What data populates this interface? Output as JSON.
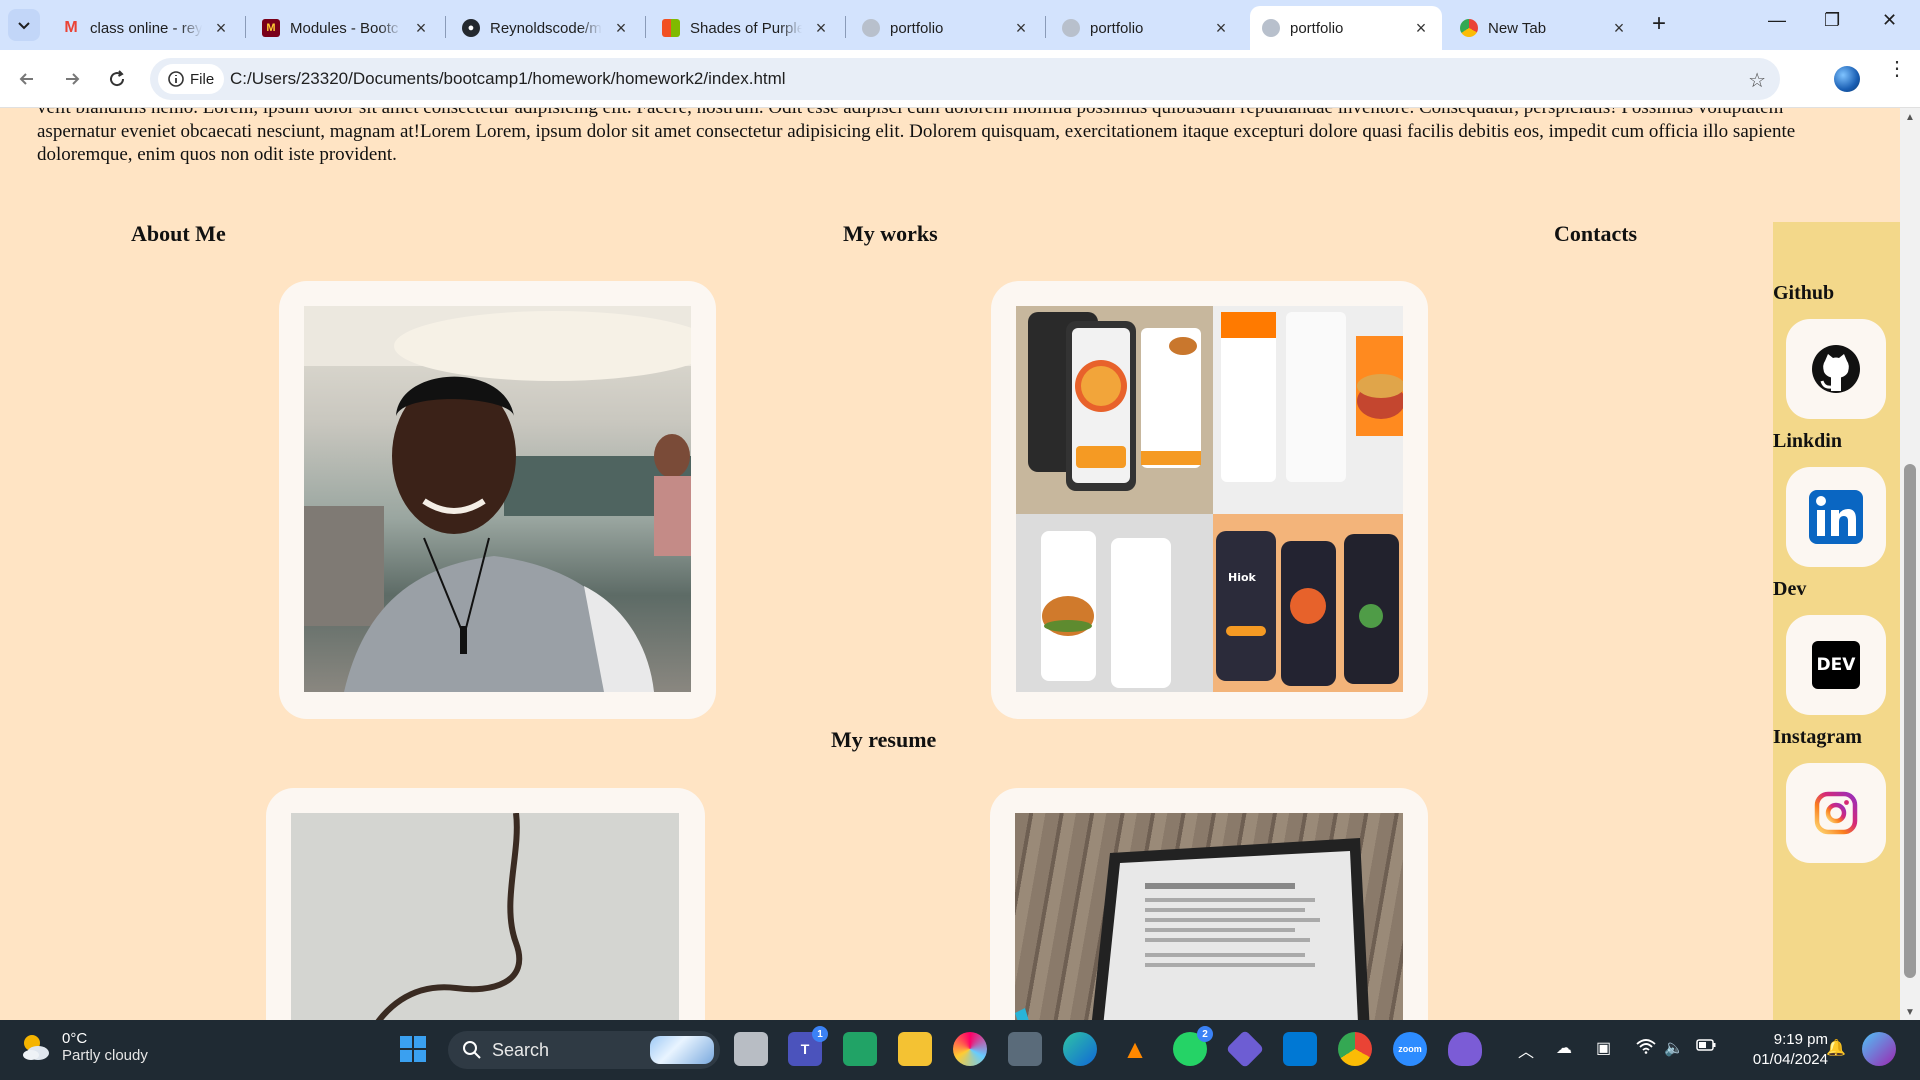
{
  "browser": {
    "tabs": [
      {
        "title": "class online - rey",
        "icon": "gmail-icon",
        "color": "#ea4335"
      },
      {
        "title": "Modules - Bootc",
        "icon": "minnesota-icon",
        "color": "#7a0019"
      },
      {
        "title": "Reynoldscode/m",
        "icon": "github-icon",
        "color": "#24292f"
      },
      {
        "title": "Shades of Purple",
        "icon": "microsoft-icon",
        "color": "#f25022"
      },
      {
        "title": "portfolio",
        "icon": "globe-icon",
        "color": "#9aa0a6"
      },
      {
        "title": "portfolio",
        "icon": "globe-icon",
        "color": "#9aa0a6"
      },
      {
        "title": "portfolio",
        "icon": "globe-icon",
        "color": "#9aa0a6"
      },
      {
        "title": "New Tab",
        "icon": "chrome-icon",
        "color": "#4285f4"
      }
    ],
    "active_tab": 6,
    "file_chip": "File",
    "url": "C:/Users/23320/Documents/bootcamp1/homework/homework2/index.html"
  },
  "page": {
    "paragraph": "velit blanditiis nemo. Lorem, ipsum dolor sit amet consectetur adipisicing elit. Facere, nostrum. Odit esse adipisci cum dolorem mollitia possimus quibusdam repudiandae inventore. Consequatur, perspiciatis! Possimus voluptatem aspernatur eveniet obcaecati nesciunt, magnam at!Lorem Lorem, ipsum dolor sit amet consectetur adipisicing elit. Dolorem quisquam, exercitationem itaque excepturi dolore quasi facilis debitis eos, impedit cum officia illo sapiente doloremque, enim quos non odit iste provident.",
    "headings": {
      "about": "About Me",
      "works": "My works",
      "contacts": "Contacts",
      "resume": "My resume"
    },
    "contacts": [
      {
        "label": "Github",
        "icon": "github-icon"
      },
      {
        "label": "Linkdin",
        "icon": "linkedin-icon"
      },
      {
        "label": "Dev",
        "icon": "dev-icon",
        "text": "DEV"
      },
      {
        "label": "Instagram",
        "icon": "instagram-icon"
      }
    ]
  },
  "taskbar": {
    "temperature": "0°C",
    "weather": "Partly cloudy",
    "search_placeholder": "Search",
    "time": "9:19 pm",
    "date": "01/04/2024",
    "teams_badge": "1",
    "whatsapp_badge": "2",
    "zoom_label": "zoom"
  }
}
